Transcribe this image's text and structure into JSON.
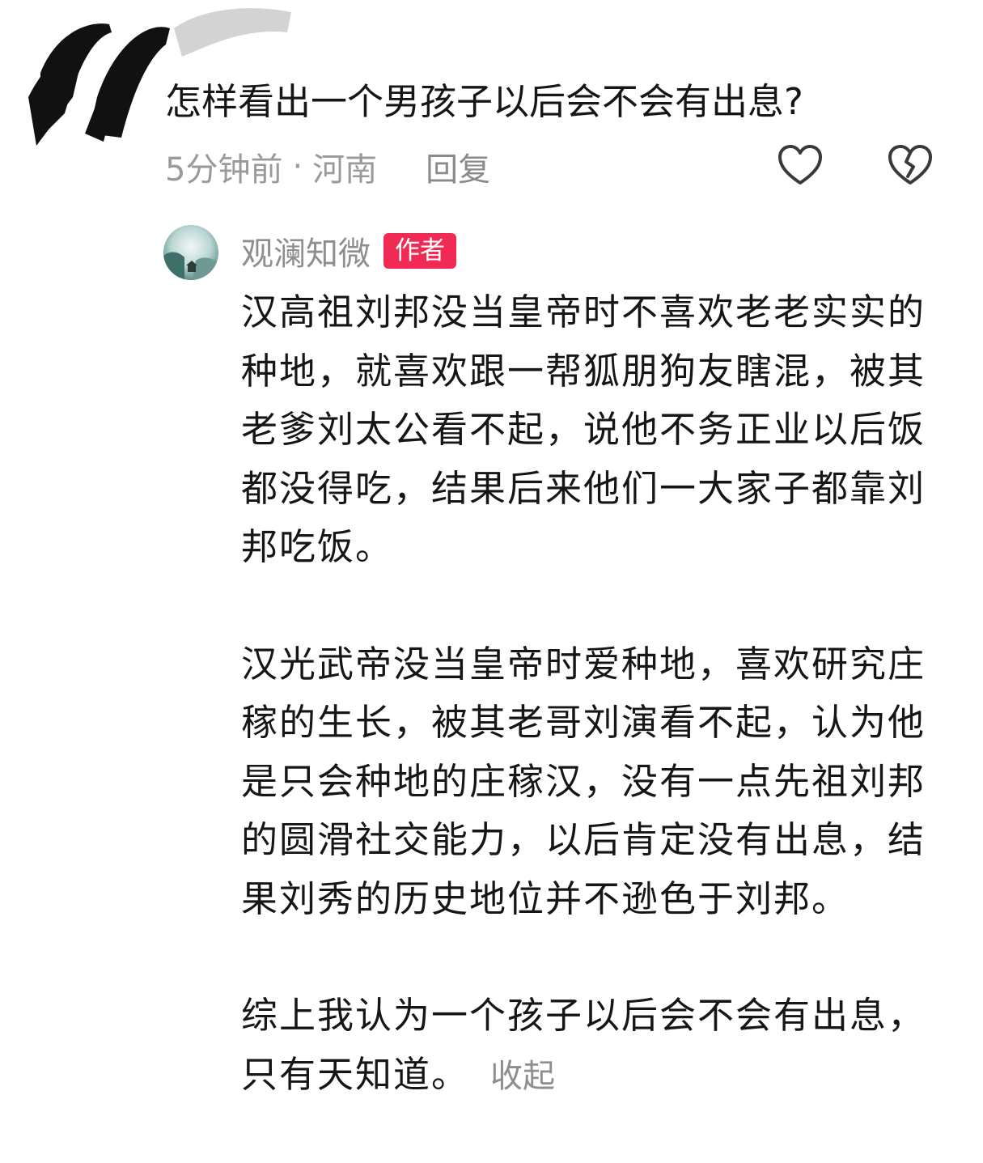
{
  "question": {
    "text": "怎样看出一个男孩子以后会不会有出息?",
    "time": "5分钟前",
    "separator": "·",
    "location": "河南",
    "reply_label": "回复",
    "like_icon": "heart-outline-icon",
    "dislike_icon": "broken-heart-icon"
  },
  "reply": {
    "author": "观澜知微",
    "badge": "作者",
    "paragraphs": [
      "汉高祖刘邦没当皇帝时不喜欢老老实实的种地，就喜欢跟一帮狐朋狗友瞎混，被其老爹刘太公看不起，说他不务正业以后饭都没得吃，结果后来他们一大家子都靠刘邦吃饭。",
      "汉光武帝没当皇帝时爱种地，喜欢研究庄稼的生长，被其老哥刘演看不起，认为他是只会种地的庄稼汉，没有一点先祖刘邦的圆滑社交能力，以后肯定没有出息，结果刘秀的历史地位并不逊色于刘邦。",
      "综上我认为一个孩子以后会不会有出息，只有天知道。"
    ],
    "collapse_label": "收起"
  },
  "colors": {
    "badge": "#f12a55",
    "meta_text": "#9a9a9a",
    "body_text": "#161616"
  }
}
